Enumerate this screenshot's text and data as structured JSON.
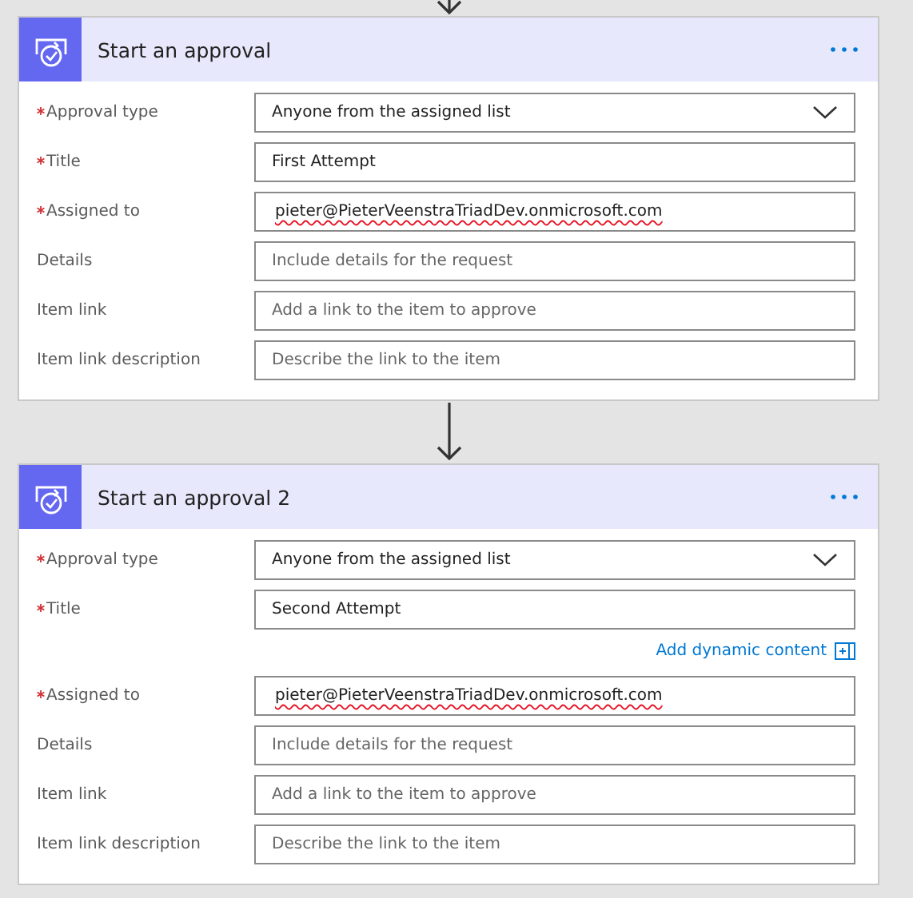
{
  "cards": [
    {
      "title": "Start an approval",
      "fields": [
        {
          "label": "Approval type",
          "required": true,
          "kind": "dropdown",
          "value": "Anyone from the assigned list"
        },
        {
          "label": "Title",
          "required": true,
          "kind": "text",
          "value": "First Attempt"
        },
        {
          "label": "Assigned to",
          "required": true,
          "kind": "text",
          "value": "pieter@PieterVeenstraTriadDev.onmicrosoft.com",
          "misspelled": true
        },
        {
          "label": "Details",
          "required": false,
          "kind": "text",
          "placeholder": "Include details for the request"
        },
        {
          "label": "Item link",
          "required": false,
          "kind": "text",
          "placeholder": "Add a link to the item to approve"
        },
        {
          "label": "Item link description",
          "required": false,
          "kind": "text",
          "placeholder": "Describe the link to the item"
        }
      ]
    },
    {
      "title": "Start an approval 2",
      "fields": [
        {
          "label": "Approval type",
          "required": true,
          "kind": "dropdown",
          "value": "Anyone from the assigned list"
        },
        {
          "label": "Title",
          "required": true,
          "kind": "text",
          "value": "Second Attempt",
          "dynamic_link": "Add dynamic content"
        },
        {
          "label": "Assigned to",
          "required": true,
          "kind": "text",
          "value": "pieter@PieterVeenstraTriadDev.onmicrosoft.com",
          "misspelled": true
        },
        {
          "label": "Details",
          "required": false,
          "kind": "text",
          "placeholder": "Include details for the request"
        },
        {
          "label": "Item link",
          "required": false,
          "kind": "text",
          "placeholder": "Add a link to the item to approve"
        },
        {
          "label": "Item link description",
          "required": false,
          "kind": "text",
          "placeholder": "Describe the link to the item"
        }
      ]
    }
  ]
}
